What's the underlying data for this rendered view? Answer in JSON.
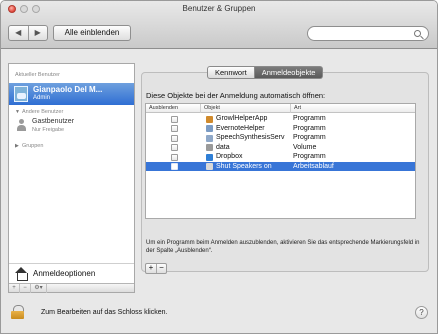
{
  "window": {
    "title": "Benutzer & Gruppen"
  },
  "toolbar": {
    "back_label": "◀",
    "forward_label": "▶",
    "show_all_label": "Alle einblenden",
    "search_placeholder": ""
  },
  "sidebar": {
    "current_header": "Aktueller Benutzer",
    "current_user": {
      "name": "Gianpaolo Del M...",
      "role": "Admin"
    },
    "other_header": "Andere Benutzer",
    "guest": {
      "name": "Gastbenutzer",
      "sub": "Nur Freigabe"
    },
    "groups_header": "Gruppen",
    "login_options_label": "Anmeldeoptionen",
    "bottom_buttons": [
      "+",
      "−",
      "⚙▾"
    ]
  },
  "tabs": [
    {
      "label": "Kennwort",
      "active": false
    },
    {
      "label": "Anmeldeobjekte",
      "active": true
    }
  ],
  "panel": {
    "instruction": "Diese Objekte bei der Anmeldung automatisch öffnen:",
    "columns": {
      "hide": "Ausblenden",
      "item": "Objekt",
      "kind": "Art"
    },
    "rows": [
      {
        "name": "GrowlHelperApp",
        "kind": "Programm",
        "icon_color": "#d08a2c",
        "icon": "growl-icon"
      },
      {
        "name": "EvernoteHelper",
        "kind": "Programm",
        "icon_color": "#7a9bc4",
        "icon": "app-icon"
      },
      {
        "name": "SpeechSynthesisServ",
        "kind": "Programm",
        "icon_color": "#8fa8c8",
        "icon": "app-icon"
      },
      {
        "name": "data",
        "kind": "Volume",
        "icon_color": "#9a9a9a",
        "icon": "volume-icon"
      },
      {
        "name": "Dropbox",
        "kind": "Programm",
        "icon_color": "#2f7fd6",
        "icon": "dropbox-icon"
      },
      {
        "name": "Shut Speakers on",
        "kind": "Arbeitsablauf",
        "icon_color": "#d9d9d9",
        "icon": "workflow-icon",
        "selected": true
      }
    ],
    "hint": "Um ein Programm beim Anmelden auszublenden, aktivieren Sie das entsprechende Markierungsfeld in der Spalte „Ausblenden“.",
    "add_label": "+",
    "remove_label": "−"
  },
  "footer": {
    "lock_text": "Zum Bearbeiten auf das Schloss klicken.",
    "help_label": "?"
  },
  "colors": {
    "selection": "#3875d7",
    "active_tab": "#666666",
    "close_button": "#e0443a"
  }
}
